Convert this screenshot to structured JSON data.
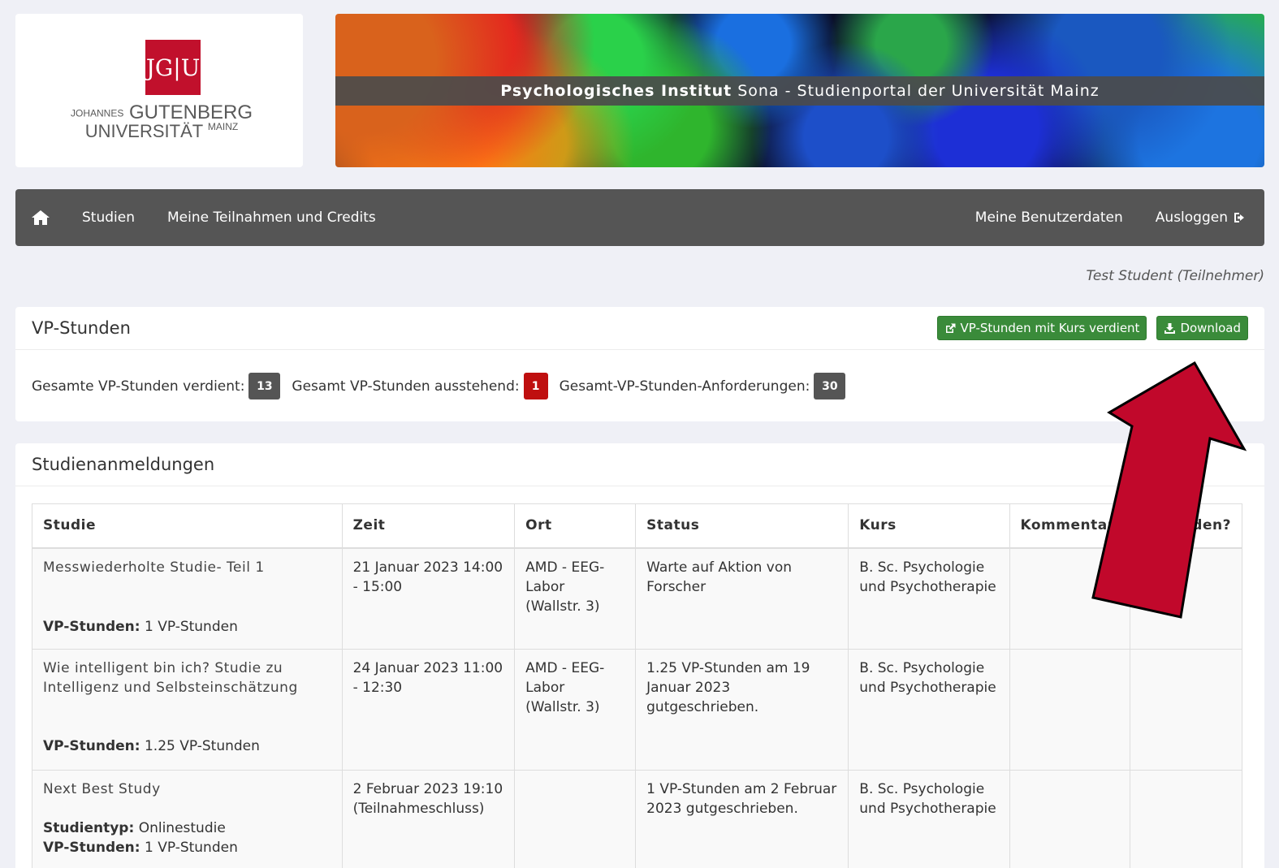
{
  "logo": {
    "mark": "JG|U",
    "line1_small": "JOHANNES",
    "line1": "GUTENBERG",
    "line2": "UNIVERSITÄT",
    "line2_small": "MAINZ"
  },
  "banner": {
    "bold": "Psychologisches Institut",
    "rest": "Sona - Studienportal der Universität Mainz"
  },
  "nav": {
    "home_icon": "home-icon",
    "studien": "Studien",
    "teilnahmen": "Meine Teilnahmen und Credits",
    "benutzerdaten": "Meine Benutzerdaten",
    "ausloggen": "Ausloggen",
    "logout_icon": "sign-out-icon"
  },
  "user_line": "Test Student (Teilnehmer)",
  "vp_panel": {
    "title": "VP-Stunden",
    "btn_kurs": "VP-Stunden mit Kurs verdient",
    "btn_download": "Download",
    "earned_label": "Gesamte VP-Stunden verdient:",
    "earned": "13",
    "pending_label": "Gesamt VP-Stunden ausstehend:",
    "pending": "1",
    "required_label": "Gesamt-VP-Stunden-Anforderungen:",
    "required": "30"
  },
  "study_panel": {
    "title": "Studienanmeldungen",
    "headers": [
      "Studie",
      "Zeit",
      "Ort",
      "Status",
      "Kurs",
      "Kommentar",
      "Abmelden?"
    ],
    "rows": [
      {
        "name": "Messwiederholte Studie- Teil 1",
        "meta_label": "VP-Stunden:",
        "meta_value": "1 VP-Stunden",
        "zeit": "21 Januar 2023 14:00 - 15:00",
        "ort": "AMD - EEG-Labor (Wallstr. 3)",
        "status": "Warte auf Aktion von Forscher",
        "kurs": "B. Sc. Psychologie und Psychotherapie",
        "kommentar": "",
        "abmelden": ""
      },
      {
        "name": "Wie intelligent bin ich? Studie zu Intelligenz und Selbsteinschätzung",
        "meta_label": "VP-Stunden:",
        "meta_value": "1.25 VP-Stunden",
        "zeit": "24 Januar 2023 11:00 - 12:30",
        "ort": "AMD - EEG-Labor (Wallstr. 3)",
        "status": "1.25 VP-Stunden am 19 Januar 2023 gutgeschrieben.",
        "kurs": "B. Sc. Psychologie und Psychotherapie",
        "kommentar": "",
        "abmelden": ""
      },
      {
        "name": "Next Best Study",
        "type_label": "Studientyp:",
        "type_value": "Onlinestudie",
        "meta_label": "VP-Stunden:",
        "meta_value": "1 VP-Stunden",
        "zeit": "2 Februar 2023 19:10 (Teilnahmeschluss)",
        "ort": "",
        "status": "1 VP-Stunden am 2 Februar 2023 gutgeschrieben.",
        "kurs": "B. Sc. Psychologie und Psychotherapie",
        "kommentar": "",
        "abmelden": ""
      }
    ]
  },
  "annotation": {
    "arrow_color": "#c1082b",
    "arrow_icon": "arrow-pointer-annotation"
  }
}
